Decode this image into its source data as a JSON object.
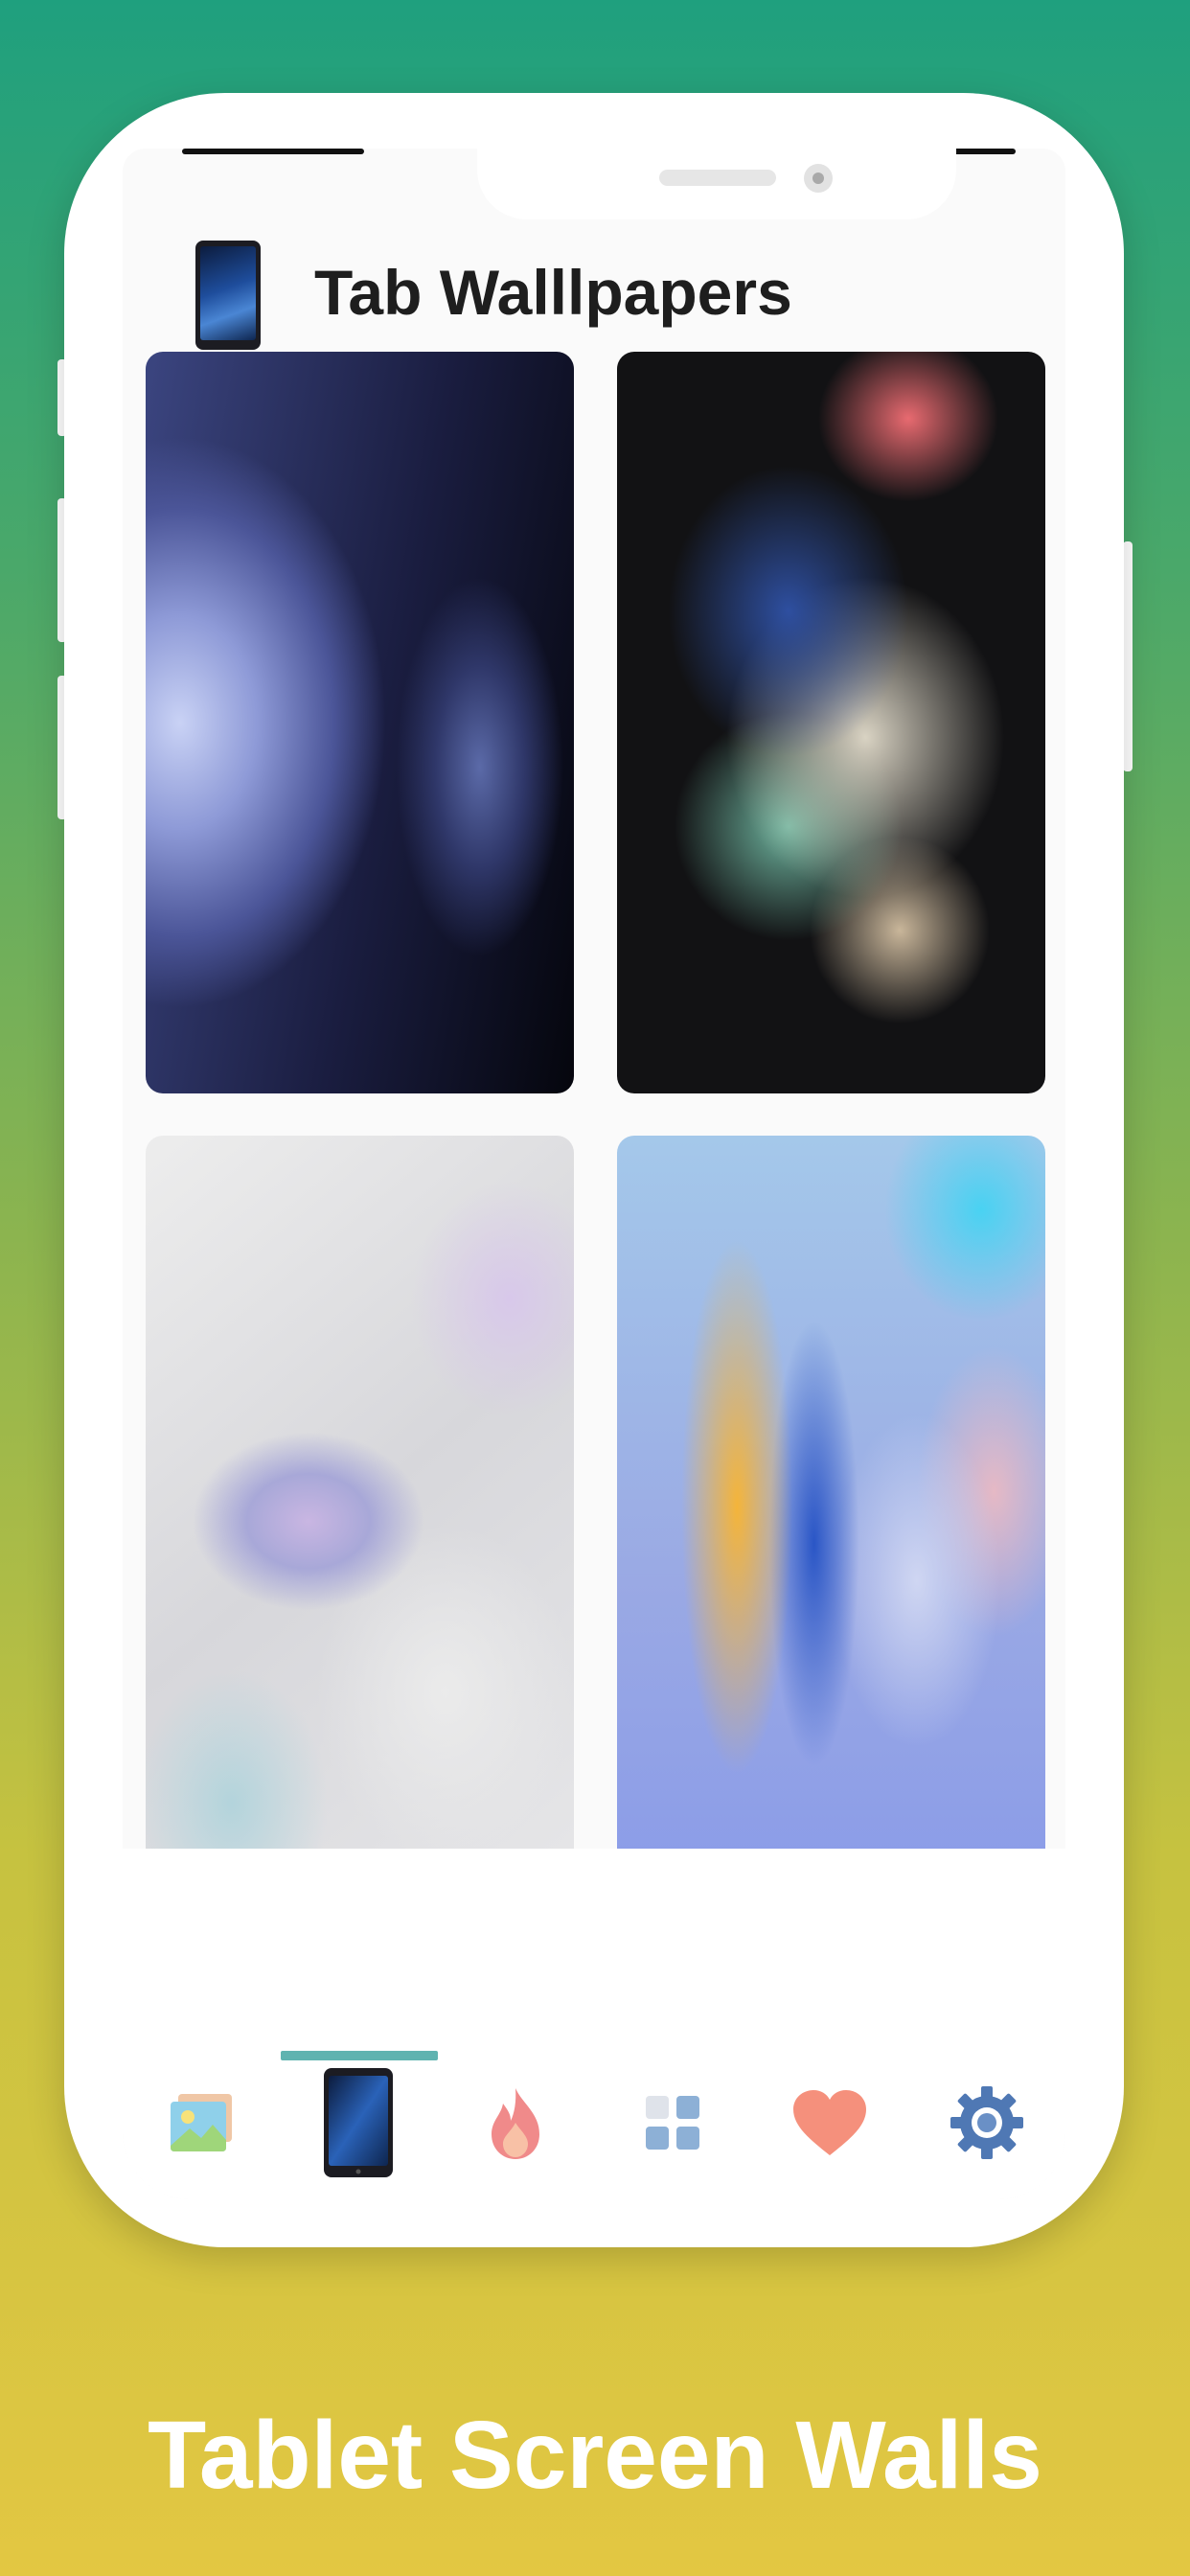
{
  "header": {
    "title": "Tab Walllpapers",
    "logo_icon": "tablet-icon"
  },
  "wallpapers": [
    {
      "description_icon": "wallpaper-thumbnail",
      "palette": "navy-blue"
    },
    {
      "description_icon": "wallpaper-thumbnail",
      "palette": "dark-pastel-burst"
    },
    {
      "description_icon": "wallpaper-thumbnail",
      "palette": "iridescent-white"
    },
    {
      "description_icon": "wallpaper-thumbnail",
      "palette": "blue-yellow-swirl"
    }
  ],
  "bottom_nav": {
    "items": [
      {
        "icon": "gallery-icon"
      },
      {
        "icon": "tablet-icon",
        "active": true
      },
      {
        "icon": "fire-icon"
      },
      {
        "icon": "categories-icon"
      },
      {
        "icon": "heart-icon"
      },
      {
        "icon": "gear-icon"
      }
    ],
    "accent_color": "#5fb3b0"
  },
  "tagline": "Tablet Screen Walls"
}
